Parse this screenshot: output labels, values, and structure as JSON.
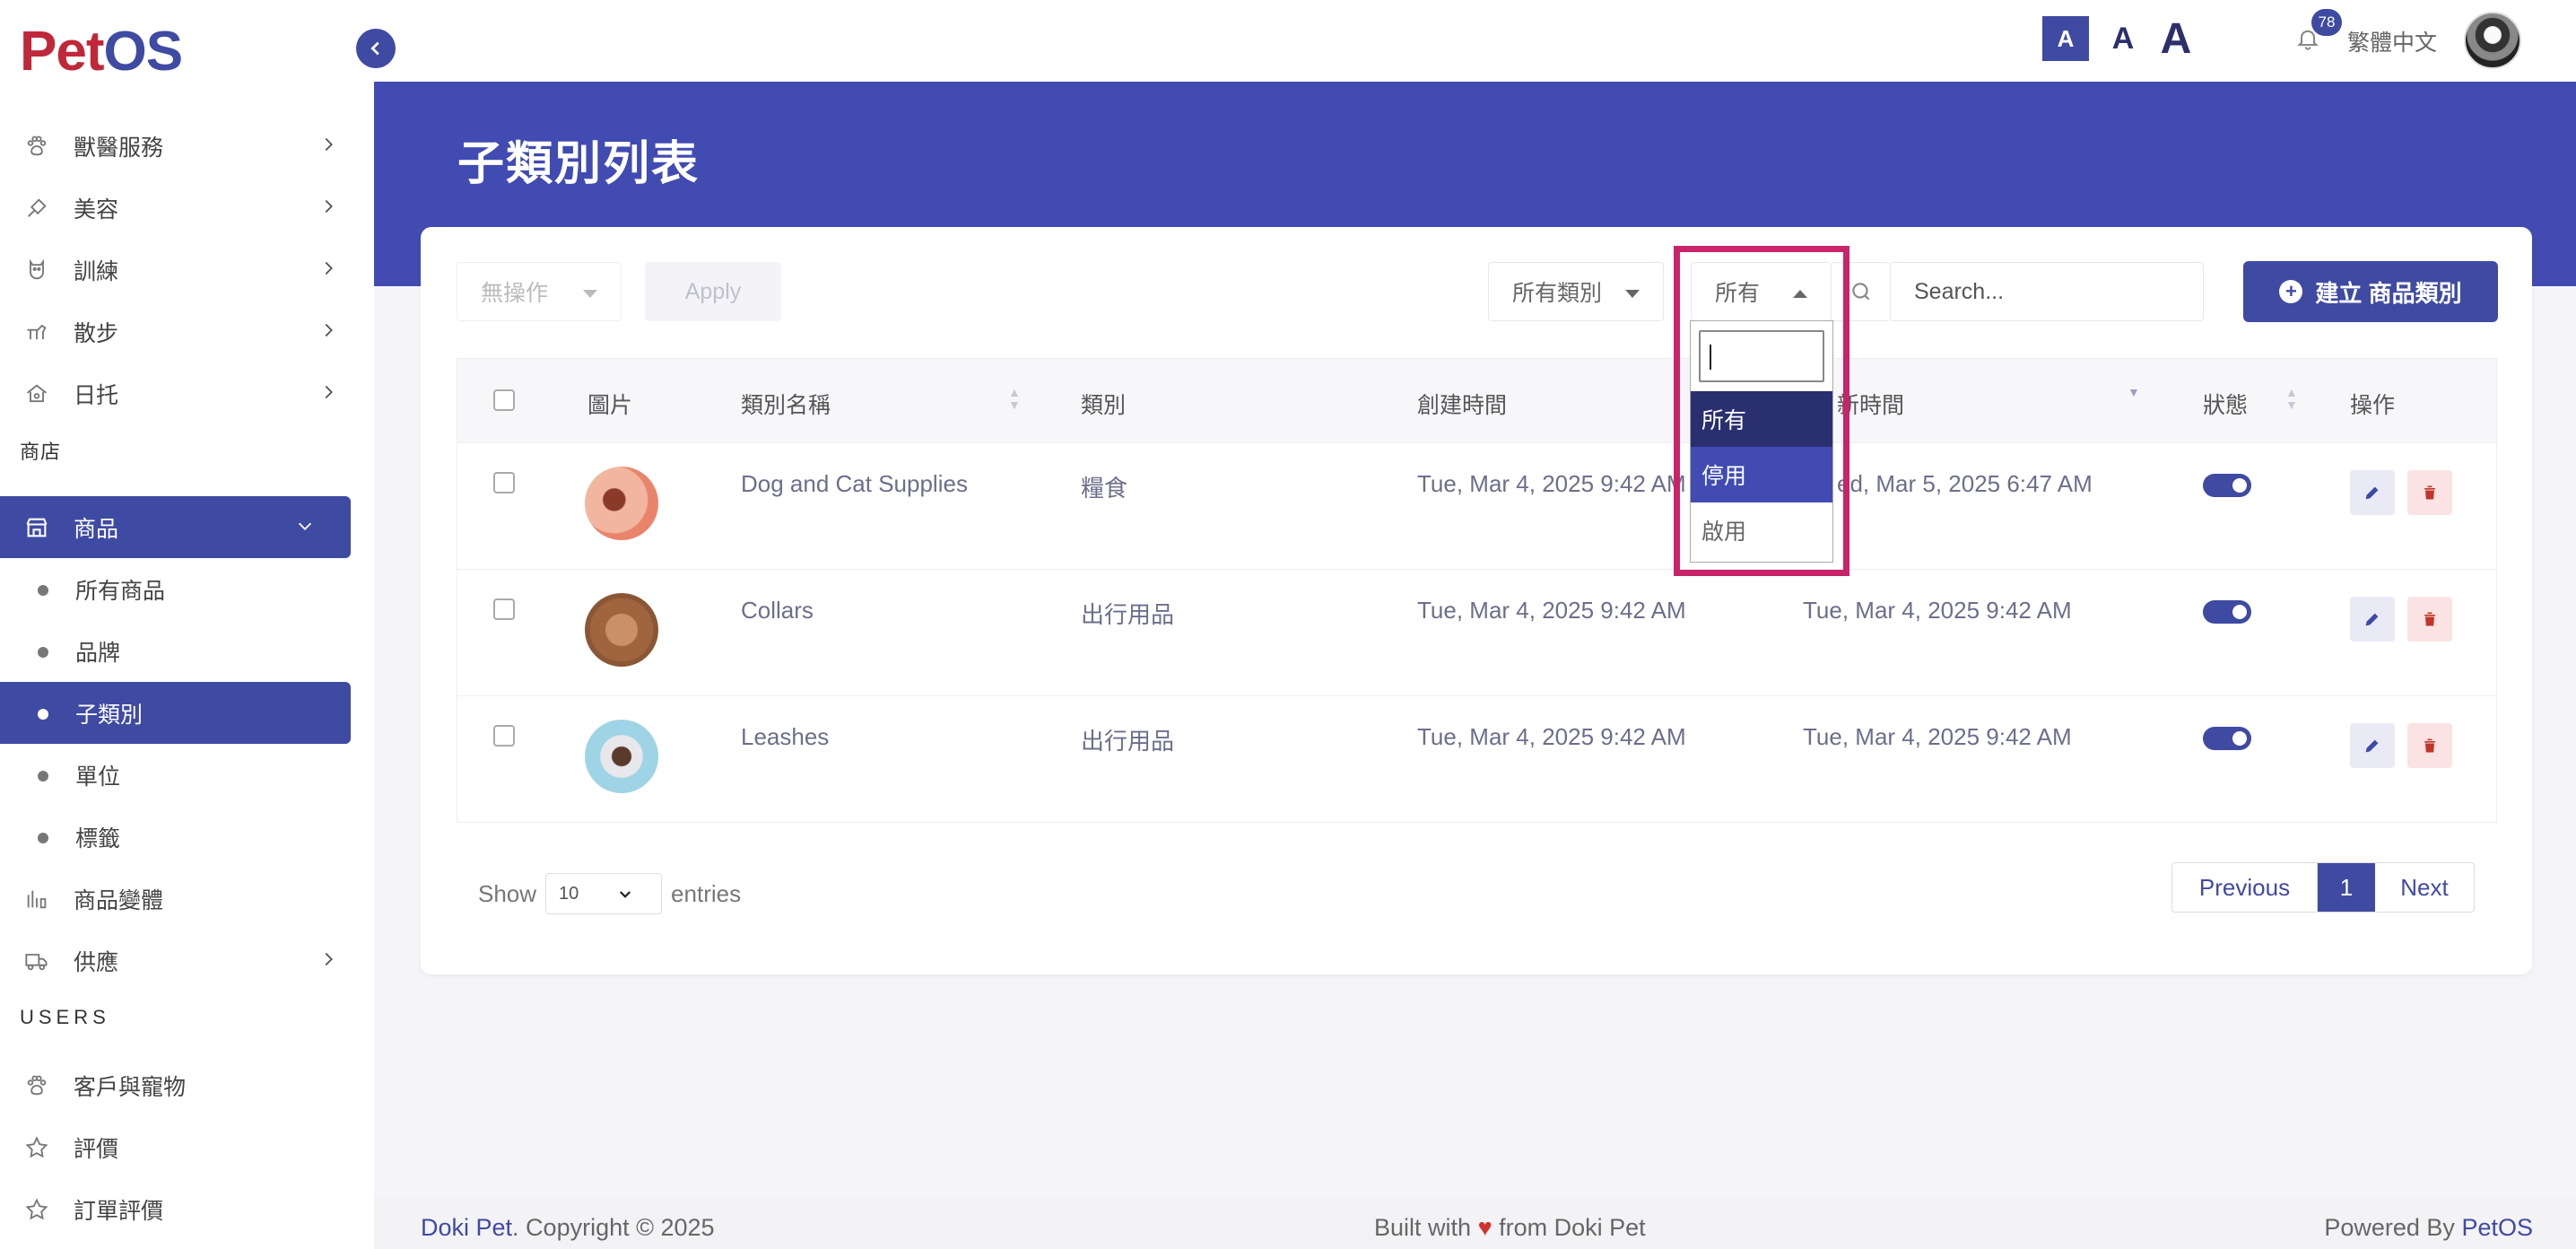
{
  "app": {
    "logo_pet": "Pet",
    "logo_os": "OS"
  },
  "topbar": {
    "font_sizes": [
      "A",
      "A",
      "A"
    ],
    "notification_count": "78",
    "language": "繁體中文"
  },
  "sidebar": {
    "items": [
      {
        "label": "獸醫服務"
      },
      {
        "label": "美容"
      },
      {
        "label": "訓練"
      },
      {
        "label": "散步"
      },
      {
        "label": "日托"
      }
    ],
    "section_store": "商店",
    "store_item": "商品",
    "store_sub": [
      "所有商品",
      "品牌",
      "子類別",
      "單位",
      "標籤"
    ],
    "variants": "商品變體",
    "supply": "供應",
    "section_users": "USERS",
    "users_items": [
      "客戶與寵物",
      "評價",
      "訂單評價"
    ]
  },
  "page": {
    "title": "子類別列表"
  },
  "toolbar": {
    "bulk_action": "無操作",
    "apply": "Apply",
    "category_filter": "所有類別",
    "status_filter": "所有",
    "search_placeholder": "Search...",
    "create_button": "建立 商品類別"
  },
  "dropdown": {
    "options": [
      "所有",
      "停用",
      "啟用"
    ]
  },
  "table": {
    "headers": {
      "image": "圖片",
      "name": "類別名稱",
      "category": "類別",
      "created": "創建時間",
      "updated_visible": "新時間",
      "status": "狀態",
      "actions": "操作"
    },
    "rows": [
      {
        "name": "Dog and Cat Supplies",
        "category": "糧食",
        "created": "Tue, Mar 4, 2025 9:42 AM",
        "updated": "Wed, Mar 5, 2025 6:47 AM",
        "updated_visible": "ed, Mar 5, 2025 6:47 AM",
        "active": true
      },
      {
        "name": "Collars",
        "category": "出行用品",
        "created": "Tue, Mar 4, 2025 9:42 AM",
        "updated": "Tue, Mar 4, 2025 9:42 AM",
        "active": true
      },
      {
        "name": "Leashes",
        "category": "出行用品",
        "created": "Tue, Mar 4, 2025 9:42 AM",
        "updated": "Tue, Mar 4, 2025 9:42 AM",
        "active": true
      }
    ]
  },
  "pagination": {
    "show": "Show",
    "per_page": "10",
    "entries": "entries",
    "previous": "Previous",
    "current": "1",
    "next": "Next"
  },
  "footer": {
    "brand": "Doki Pet",
    "copyright": ". Copyright © 2025",
    "built_prefix": "Built with",
    "built_suffix": "from Doki Pet",
    "powered_prefix": "Powered By",
    "powered_brand": "PetOS"
  },
  "colors": {
    "primary": "#3f4aa3",
    "band": "#414bb2",
    "highlight": "#c8246a",
    "logo_red": "#c0283a"
  }
}
